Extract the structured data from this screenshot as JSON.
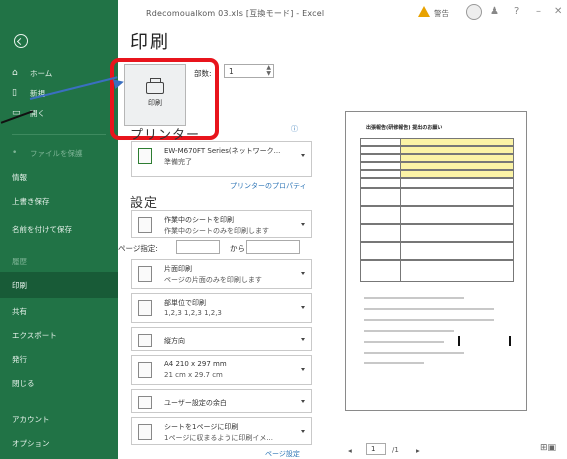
{
  "titlebar": {
    "title": "Rdecomoualkom 03.xls  [互換モード]  -  Excel",
    "warning": "警告"
  },
  "sidebar": {
    "items": [
      {
        "icon": "home-icon",
        "label": "ホーム"
      },
      {
        "icon": "new-icon",
        "label": "新規"
      },
      {
        "icon": "open-icon",
        "label": "開く"
      },
      {
        "icon": "",
        "label": "ファイルを保護"
      },
      {
        "icon": "",
        "label": "情報"
      },
      {
        "icon": "",
        "label": "上書き保存"
      },
      {
        "icon": "",
        "label": "名前を付けて保存"
      },
      {
        "icon": "",
        "label": "履歴"
      },
      {
        "icon": "",
        "label": "印刷"
      },
      {
        "icon": "",
        "label": "共有"
      },
      {
        "icon": "",
        "label": "エクスポート"
      },
      {
        "icon": "",
        "label": "発行"
      },
      {
        "icon": "",
        "label": "閉じる"
      },
      {
        "icon": "",
        "label": "アカウント"
      },
      {
        "icon": "",
        "label": "オプション"
      }
    ]
  },
  "print": {
    "title": "印刷",
    "button_label": "印刷",
    "copies_label": "部数:",
    "copies_value": "1"
  },
  "printer": {
    "section_title": "プリンター",
    "name": "EW-M670FT Series(ネットワーク...",
    "status": "準備完了",
    "properties_link": "プリンターのプロパティ"
  },
  "settings": {
    "section_title": "設定",
    "pages_label": "ページ指定:",
    "pages_to": "から",
    "options": [
      {
        "l1": "作業中のシートを印刷",
        "l2": "作業中のシートのみを印刷します"
      },
      {
        "l1": "片面印刷",
        "l2": "ページの片面のみを印刷します"
      },
      {
        "l1": "部単位で印刷",
        "l2": "1,2,3    1,2,3    1,2,3"
      },
      {
        "l1": "縦方向",
        "l2": ""
      },
      {
        "l1": "A4 210 x 297 mm",
        "l2": "21 cm x 29.7 cm"
      },
      {
        "l1": "ユーザー設定の余白",
        "l2": ""
      },
      {
        "l1": "シートを1ページに印刷",
        "l2": "1ページに収まるように印刷イメ..."
      }
    ],
    "page_setup_link": "ページ設定"
  },
  "preview": {
    "doc_title": "出張報告(研修報告) 提出のお願い",
    "current_page": "1",
    "total_pages": "/1"
  },
  "colors": {
    "sidebar": "#217346",
    "highlight": "#e8141c",
    "arrow": "#3a6fc0"
  }
}
